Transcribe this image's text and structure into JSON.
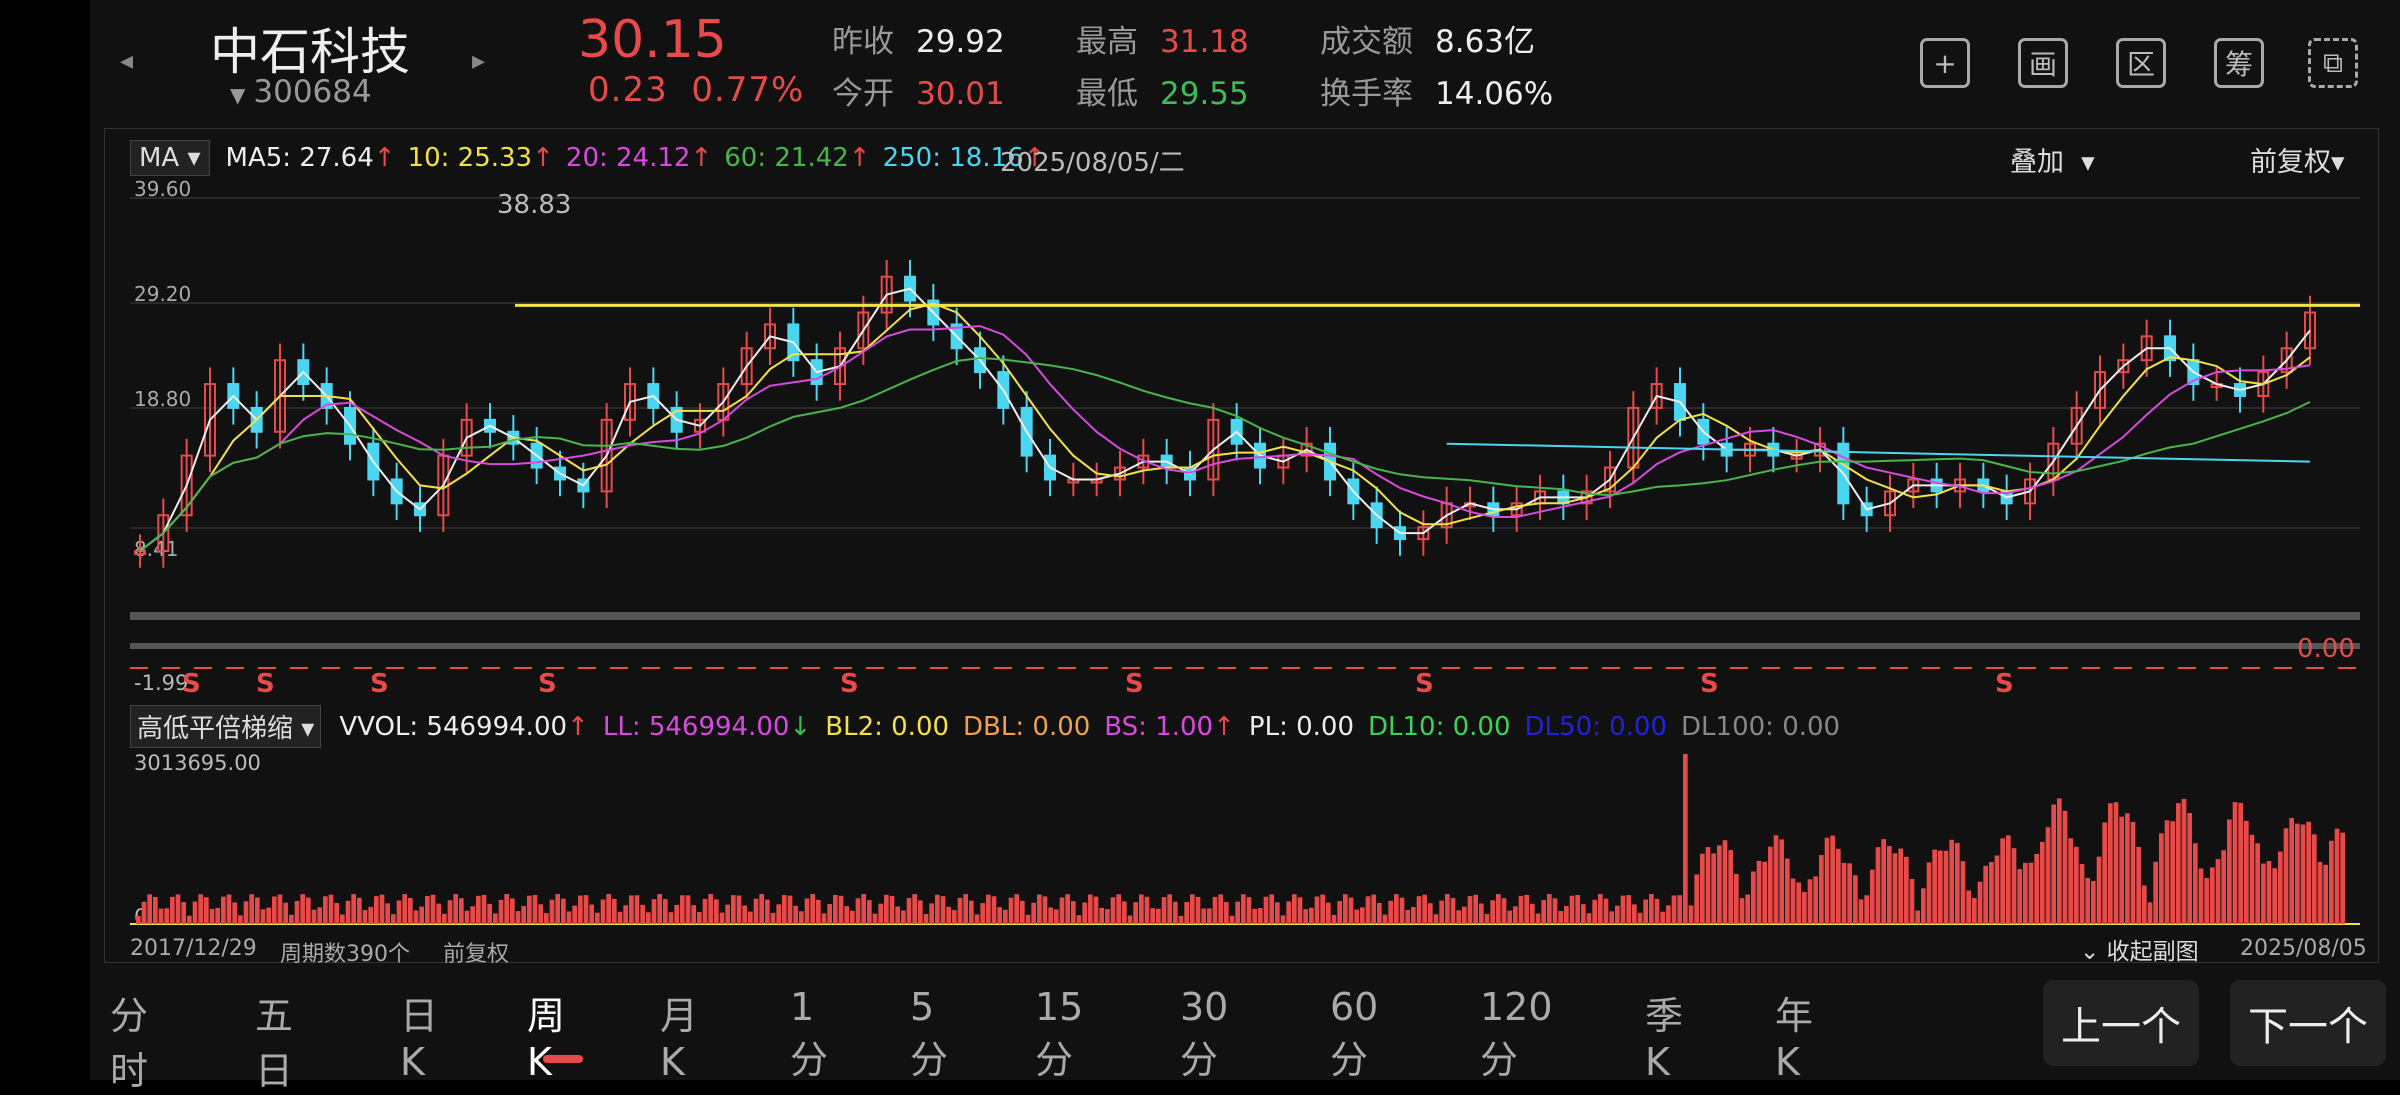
{
  "header": {
    "name": "中石科技",
    "code": "300684",
    "price": "30.15",
    "change": "0.23",
    "change_pct": "0.77%",
    "quotes": [
      {
        "label": "昨收",
        "value": "29.92",
        "color": "white"
      },
      {
        "label": "今开",
        "value": "30.01",
        "color": "red"
      },
      {
        "label": "最高",
        "value": "31.18",
        "color": "red"
      },
      {
        "label": "最低",
        "value": "29.55",
        "color": "green"
      },
      {
        "label": "成交额",
        "value": "8.63亿",
        "color": "white"
      },
      {
        "label": "换手率",
        "value": "14.06%",
        "color": "white"
      }
    ],
    "tools": [
      "+",
      "画",
      "区",
      "筹",
      "⧉"
    ],
    "tool_icons": [
      "plus-icon",
      "draw-icon",
      "range-icon",
      "chips-icon",
      "landscape-icon"
    ]
  },
  "ma": {
    "button": "MA",
    "items": [
      {
        "text": "MA5: 27.64",
        "color": "#eeeeee"
      },
      {
        "text": "10: 25.33",
        "color": "#f3e14a"
      },
      {
        "text": "20: 24.12",
        "color": "#d84adf"
      },
      {
        "text": "60: 21.42",
        "color": "#48b64a"
      },
      {
        "text": "250: 18.16",
        "color": "#4ad6f0"
      }
    ],
    "date": "2025/08/05/二",
    "overlay": "叠加",
    "adjust": "前复权"
  },
  "main_chart": {
    "y_ticks": [
      "39.60",
      "29.20",
      "18.80",
      "8.41"
    ],
    "peak_label": "38.83",
    "bottom_label": "-1.99",
    "sub_value": "0.00",
    "signal": "S"
  },
  "indicator": {
    "button": "高低平倍梯缩",
    "items": [
      {
        "text": "VVOL: 546994.00",
        "color": "#eeeeee",
        "arrow": "↑"
      },
      {
        "text": "LL: 546994.00",
        "color": "#d84adf",
        "arrow": "↓"
      },
      {
        "text": "BL2: 0.00",
        "color": "#f3e14a",
        "arrow": ""
      },
      {
        "text": "DBL: 0.00",
        "color": "#f0a04a",
        "arrow": ""
      },
      {
        "text": "BS: 1.00",
        "color": "#d84adf",
        "arrow": "↑"
      },
      {
        "text": "PL: 0.00",
        "color": "#eeeeee",
        "arrow": ""
      },
      {
        "text": "DL10: 0.00",
        "color": "#3cd25a",
        "arrow": ""
      },
      {
        "text": "DL50: 0.00",
        "color": "#2222dd",
        "arrow": ""
      },
      {
        "text": "DL100: 0.00",
        "color": "#888888",
        "arrow": ""
      }
    ],
    "max_label": "3013695.00",
    "zero_label": "0"
  },
  "footer": {
    "start_date": "2017/12/29",
    "periods": "周期数390个",
    "adjust": "前复权",
    "collapse": "收起副图",
    "end_date": "2025/08/05"
  },
  "tabs": [
    "分时",
    "五日",
    "日K",
    "周K",
    "月K",
    "1分",
    "5分",
    "15分",
    "30分",
    "60分",
    "120分",
    "季K",
    "年K"
  ],
  "active_tab": "周K",
  "prev_btn": "上一个",
  "next_btn": "下一个",
  "chart_data": {
    "type": "line",
    "title": "",
    "x_range": [
      "2017/12/29",
      "2025/08/05"
    ],
    "ylim": [
      8.41,
      39.6
    ],
    "resistance_level": 30.6,
    "close_series": [
      10,
      13,
      18,
      24,
      22,
      20,
      26,
      24,
      22,
      19,
      16,
      14,
      13,
      18,
      21,
      20,
      19,
      17,
      16,
      15,
      21,
      24,
      22,
      20,
      21,
      24,
      27,
      29,
      26,
      24,
      27,
      30,
      33,
      31,
      29,
      27,
      25,
      22,
      18,
      16,
      16,
      16,
      17,
      18,
      17,
      16,
      21,
      19,
      17,
      18,
      19,
      16,
      14,
      12,
      11,
      12,
      14,
      14,
      13,
      14,
      15,
      14,
      15,
      17,
      22,
      24,
      21,
      19,
      18,
      19,
      18,
      18,
      19,
      14,
      13,
      15,
      16,
      15,
      16,
      15,
      14,
      16,
      19,
      22,
      25,
      26,
      28,
      26,
      24,
      24,
      23,
      25,
      27,
      30
    ]
  }
}
